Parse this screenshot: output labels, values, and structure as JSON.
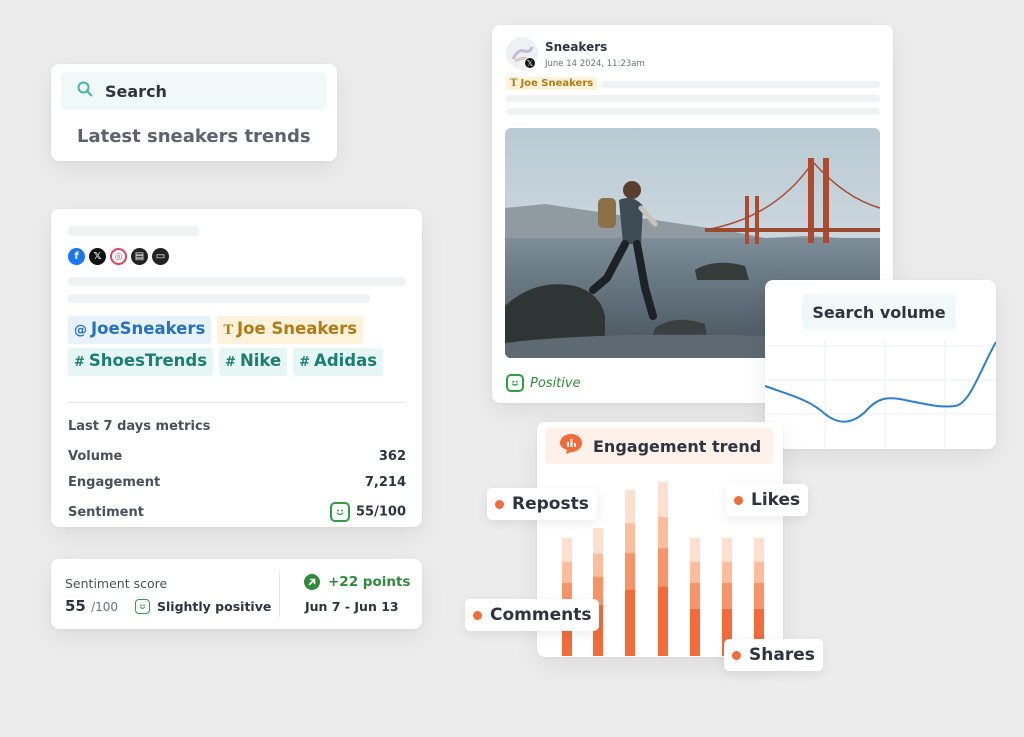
{
  "search": {
    "label": "Search",
    "query": "Latest sneakers trends"
  },
  "profile": {
    "socials": [
      {
        "name": "facebook",
        "glyph": "f",
        "color": "#1877f2"
      },
      {
        "name": "x",
        "glyph": "𝕏",
        "color": "#111111"
      },
      {
        "name": "instagram",
        "glyph": "◎",
        "color": "#e4405f"
      },
      {
        "name": "news",
        "glyph": "▤",
        "color": "#222222"
      },
      {
        "name": "forum",
        "glyph": "▭",
        "color": "#222222"
      }
    ],
    "tags": [
      {
        "prefix": "@",
        "text": "JoeSneakers",
        "style": "blue"
      },
      {
        "prefix": "T",
        "text": "Joe Sneakers",
        "style": "yellow"
      },
      {
        "prefix": "#",
        "text": "ShoesTrends",
        "style": "green"
      },
      {
        "prefix": "#",
        "text": "Nike",
        "style": "green"
      },
      {
        "prefix": "#",
        "text": "Adidas",
        "style": "green"
      }
    ],
    "metrics_title": "Last 7 days metrics",
    "metrics": {
      "volume": {
        "label": "Volume",
        "value": "362"
      },
      "engagement": {
        "label": "Engagement",
        "value": "7,214"
      },
      "sentiment": {
        "label": "Sentiment",
        "value": "55/100"
      }
    }
  },
  "score": {
    "title": "Sentiment score",
    "value": "55",
    "max": "/100",
    "sentiment": "Slightly positive",
    "change": "+22 points",
    "range": "Jun 7 - Jun 13"
  },
  "post": {
    "name": "Sneakers",
    "date": "June 14 2024, 11:23am",
    "author": "Joe Sneakers",
    "sentiment": "Positive"
  },
  "volume": {
    "title": "Search volume"
  },
  "engagement": {
    "title": "Engagement trend",
    "legend": {
      "reposts": "Reposts",
      "likes": "Likes",
      "comments": "Comments",
      "shares": "Shares"
    },
    "colors": [
      "#f26b38",
      "#f79467",
      "#fbbd9d",
      "#fde0cf"
    ]
  },
  "colors": {
    "accent": "#f26b38",
    "positive": "#2e8b3a",
    "teal": "#1a7f72"
  }
}
